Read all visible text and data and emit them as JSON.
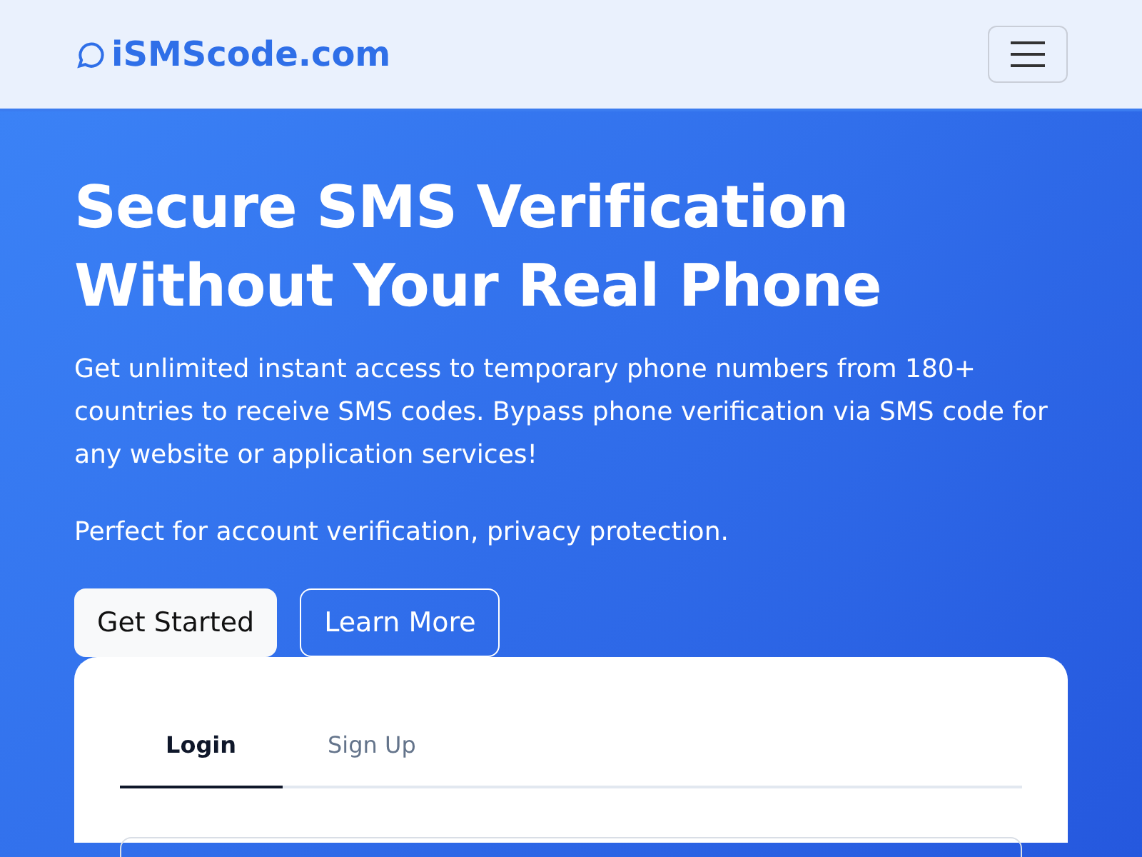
{
  "brand": {
    "name": "iSMScode.com"
  },
  "hero": {
    "title_lines": [
      "Secure SMS Verification",
      "Without Your Real Phone"
    ],
    "paragraphs": [
      "Get unlimited instant access to temporary phone numbers from 180+ countries to receive SMS codes. Bypass phone verification via SMS code for any website or application services!",
      "Perfect for account verification, privacy protection."
    ],
    "buttons": [
      {
        "label": "Get Started",
        "kind": "solid"
      },
      {
        "label": "Learn More",
        "kind": "outline"
      }
    ]
  },
  "auth_card": {
    "tabs": [
      {
        "label": "Login",
        "selected": true
      },
      {
        "label": "Sign Up",
        "selected": false
      }
    ]
  }
}
